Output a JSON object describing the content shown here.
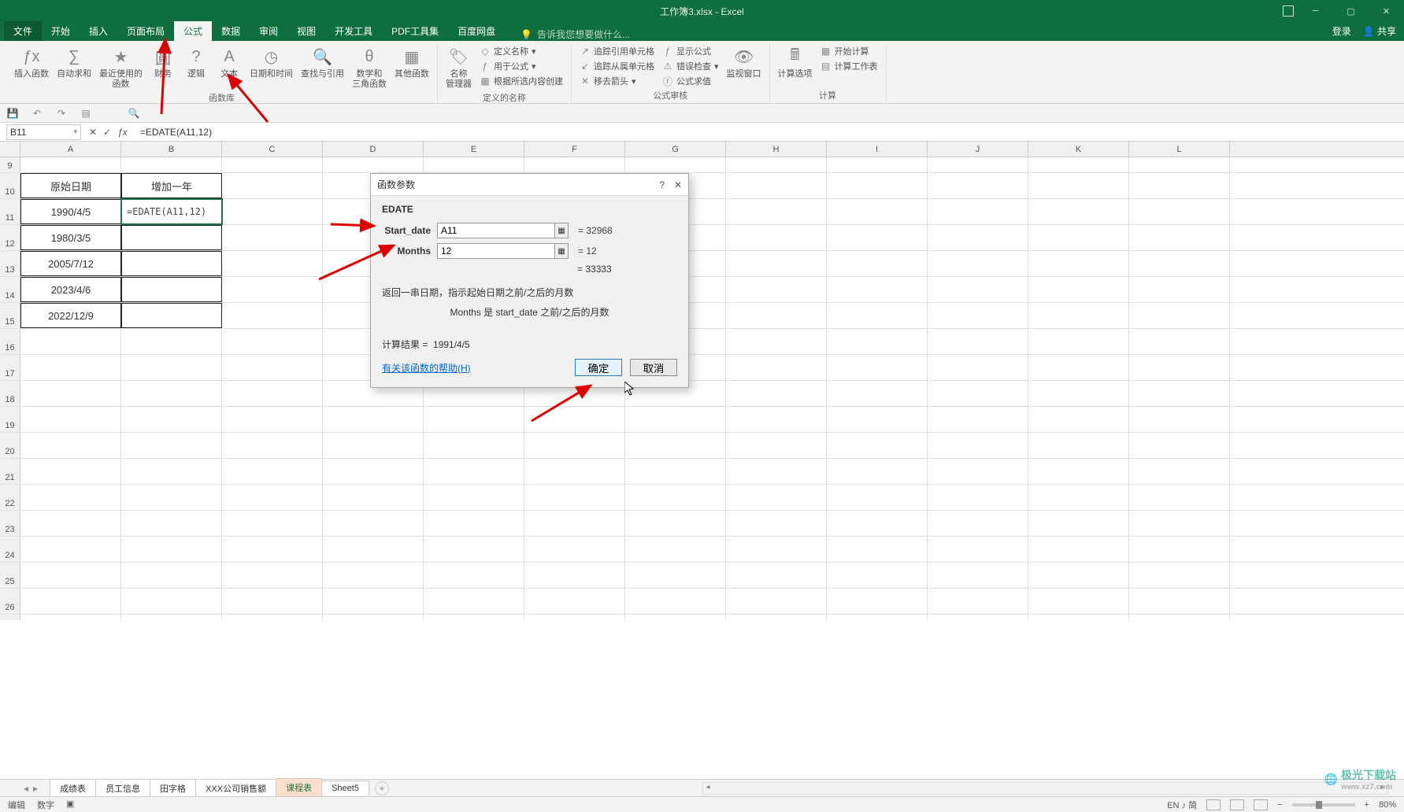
{
  "titlebar": {
    "title": "工作簿3.xlsx - Excel"
  },
  "menutabs": {
    "file": "文件",
    "tabs": [
      "开始",
      "插入",
      "页面布局",
      "公式",
      "数据",
      "审阅",
      "视图",
      "开发工具",
      "PDF工具集",
      "百度网盘"
    ],
    "active_index": 3,
    "tell_me": "告诉我您想要做什么...",
    "login": "登录",
    "share": "共享"
  },
  "ribbon": {
    "groups": {
      "fn_lib": {
        "label": "函数库",
        "insert_fn": "插入函数",
        "autosum": "自动求和",
        "recent": "最近使用的\n函数",
        "financial": "财务",
        "logical": "逻辑",
        "text": "文本",
        "datetime": "日期和时间",
        "lookup": "查找与引用",
        "math": "数学和\n三角函数",
        "other": "其他函数"
      },
      "names": {
        "label": "定义的名称",
        "name_mgr": "名称\n管理器",
        "define": "定义名称",
        "use_in": "用于公式",
        "create_from": "根据所选内容创建"
      },
      "audit": {
        "label": "公式审核",
        "trace_prec": "追踪引用单元格",
        "trace_dep": "追踪从属单元格",
        "remove_arrows": "移去箭头",
        "show_formulas": "显示公式",
        "error_check": "错误检查",
        "evaluate": "公式求值",
        "watch": "监视窗口"
      },
      "calc": {
        "label": "计算",
        "options": "计算选项",
        "calc_now": "开始计算",
        "calc_sheet": "计算工作表"
      }
    }
  },
  "formula_bar": {
    "name_box": "B11",
    "formula": "=EDATE(A11,12)"
  },
  "columns": [
    "A",
    "B",
    "C",
    "D",
    "E",
    "F",
    "G",
    "H",
    "I",
    "J",
    "K",
    "L"
  ],
  "first_row": 9,
  "row_count": 19,
  "head_row": 10,
  "data": {
    "headers": {
      "A": "原始日期",
      "B": "增加一年"
    },
    "rows": [
      {
        "r": 11,
        "A": "1990/4/5",
        "B": "=EDATE(A11,12)"
      },
      {
        "r": 12,
        "A": "1980/3/5"
      },
      {
        "r": 13,
        "A": "2005/7/12"
      },
      {
        "r": 14,
        "A": "2023/4/6"
      },
      {
        "r": 15,
        "A": "2022/12/9"
      }
    ]
  },
  "dialog": {
    "title": "函数参数",
    "fn": "EDATE",
    "args": [
      {
        "label": "Start_date",
        "value": "A11",
        "result": "= 32968"
      },
      {
        "label": "Months",
        "value": "12",
        "result": "= 12"
      }
    ],
    "fn_result": "= 33333",
    "desc": "返回一串日期，指示起始日期之前/之后的月数",
    "arg_desc": "Months  是 start_date 之前/之后的月数",
    "calc_result_label": "计算结果 =",
    "calc_result": "1991/4/5",
    "help": "有关该函数的帮助(H)",
    "ok": "确定",
    "cancel": "取消"
  },
  "sheet_tabs": {
    "tabs": [
      "成绩表",
      "员工信息",
      "田字格",
      "XXX公司销售额",
      "课程表",
      "Sheet5"
    ],
    "active_index": 4
  },
  "status_bar": {
    "left": [
      "编辑",
      "数字"
    ],
    "ime": "EN ♪ 简",
    "zoom": "80%"
  },
  "watermark": {
    "main": "极光下载站",
    "sub": "www.xz7.com"
  }
}
